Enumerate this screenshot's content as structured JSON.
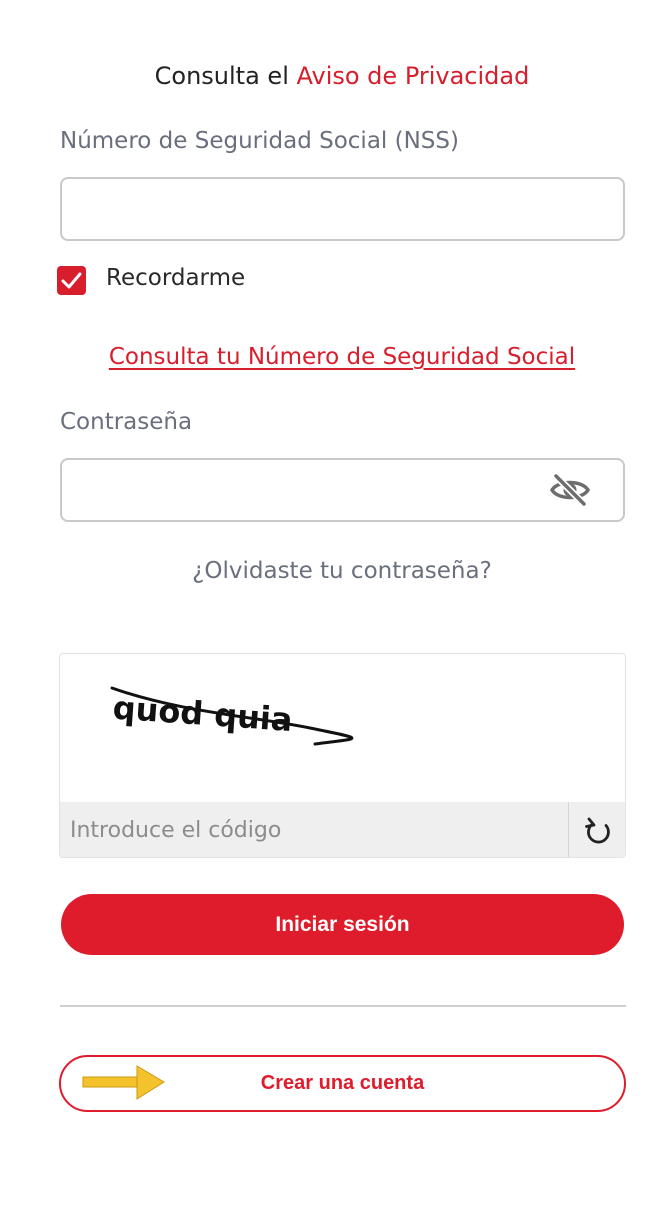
{
  "privacy": {
    "prefix": "Consulta el ",
    "link_label": "Aviso de Privacidad"
  },
  "nss": {
    "label": "Número de Seguridad Social (NSS)",
    "value": "",
    "placeholder": ""
  },
  "remember": {
    "label": "Recordarme",
    "checked": true
  },
  "nss_lookup_link": "Consulta tu Número de Seguridad Social",
  "password": {
    "label": "Contraseña",
    "value": "",
    "placeholder": "",
    "toggle_icon": "eye-slash-icon"
  },
  "forgot_password_link": "¿Olvidaste tu contraseña?",
  "captcha": {
    "code_text": "quod quia",
    "input_placeholder": "Introduce el código",
    "refresh_icon": "refresh-icon"
  },
  "buttons": {
    "login_label": "Iniciar sesión",
    "create_account_label": "Crear una cuenta"
  },
  "annotation": {
    "icon": "arrow-right-icon",
    "color": "#f4c22b"
  },
  "colors": {
    "brand_red": "#df1c2c",
    "muted_text": "#6a6f7e",
    "border": "#c9c9c9"
  }
}
